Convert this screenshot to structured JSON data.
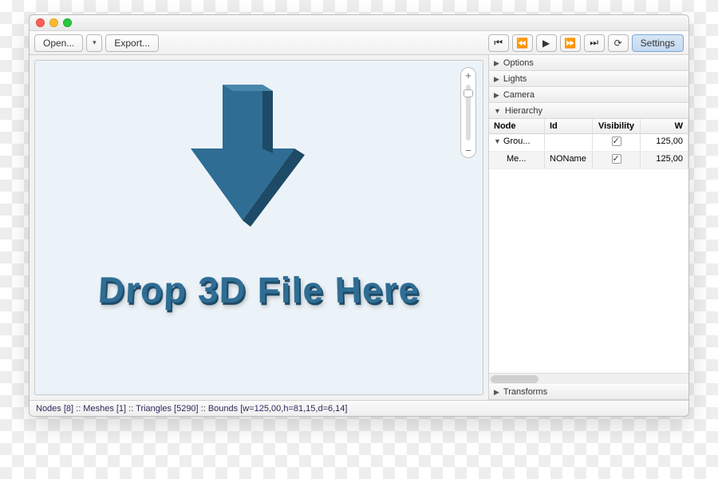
{
  "toolbar": {
    "open_label": "Open...",
    "export_label": "Export...",
    "settings_label": "Settings"
  },
  "viewport": {
    "drop_text": "Drop 3D File Here"
  },
  "sidebar": {
    "panels": {
      "options": "Options",
      "lights": "Lights",
      "camera": "Camera",
      "hierarchy": "Hierarchy",
      "transforms": "Transforms"
    },
    "table": {
      "headers": {
        "node": "Node",
        "id": "Id",
        "visibility": "Visibility",
        "w": "W"
      },
      "rows": [
        {
          "node": "Grou...",
          "id": "",
          "visibility": true,
          "w": "125,00"
        },
        {
          "node": "Me...",
          "id": "NOName",
          "visibility": true,
          "w": "125,00"
        }
      ]
    }
  },
  "status": {
    "text": "Nodes [8] :: Meshes [1] :: Triangles [5290] :: Bounds [w=125,00,h=81,15,d=6,14]"
  }
}
